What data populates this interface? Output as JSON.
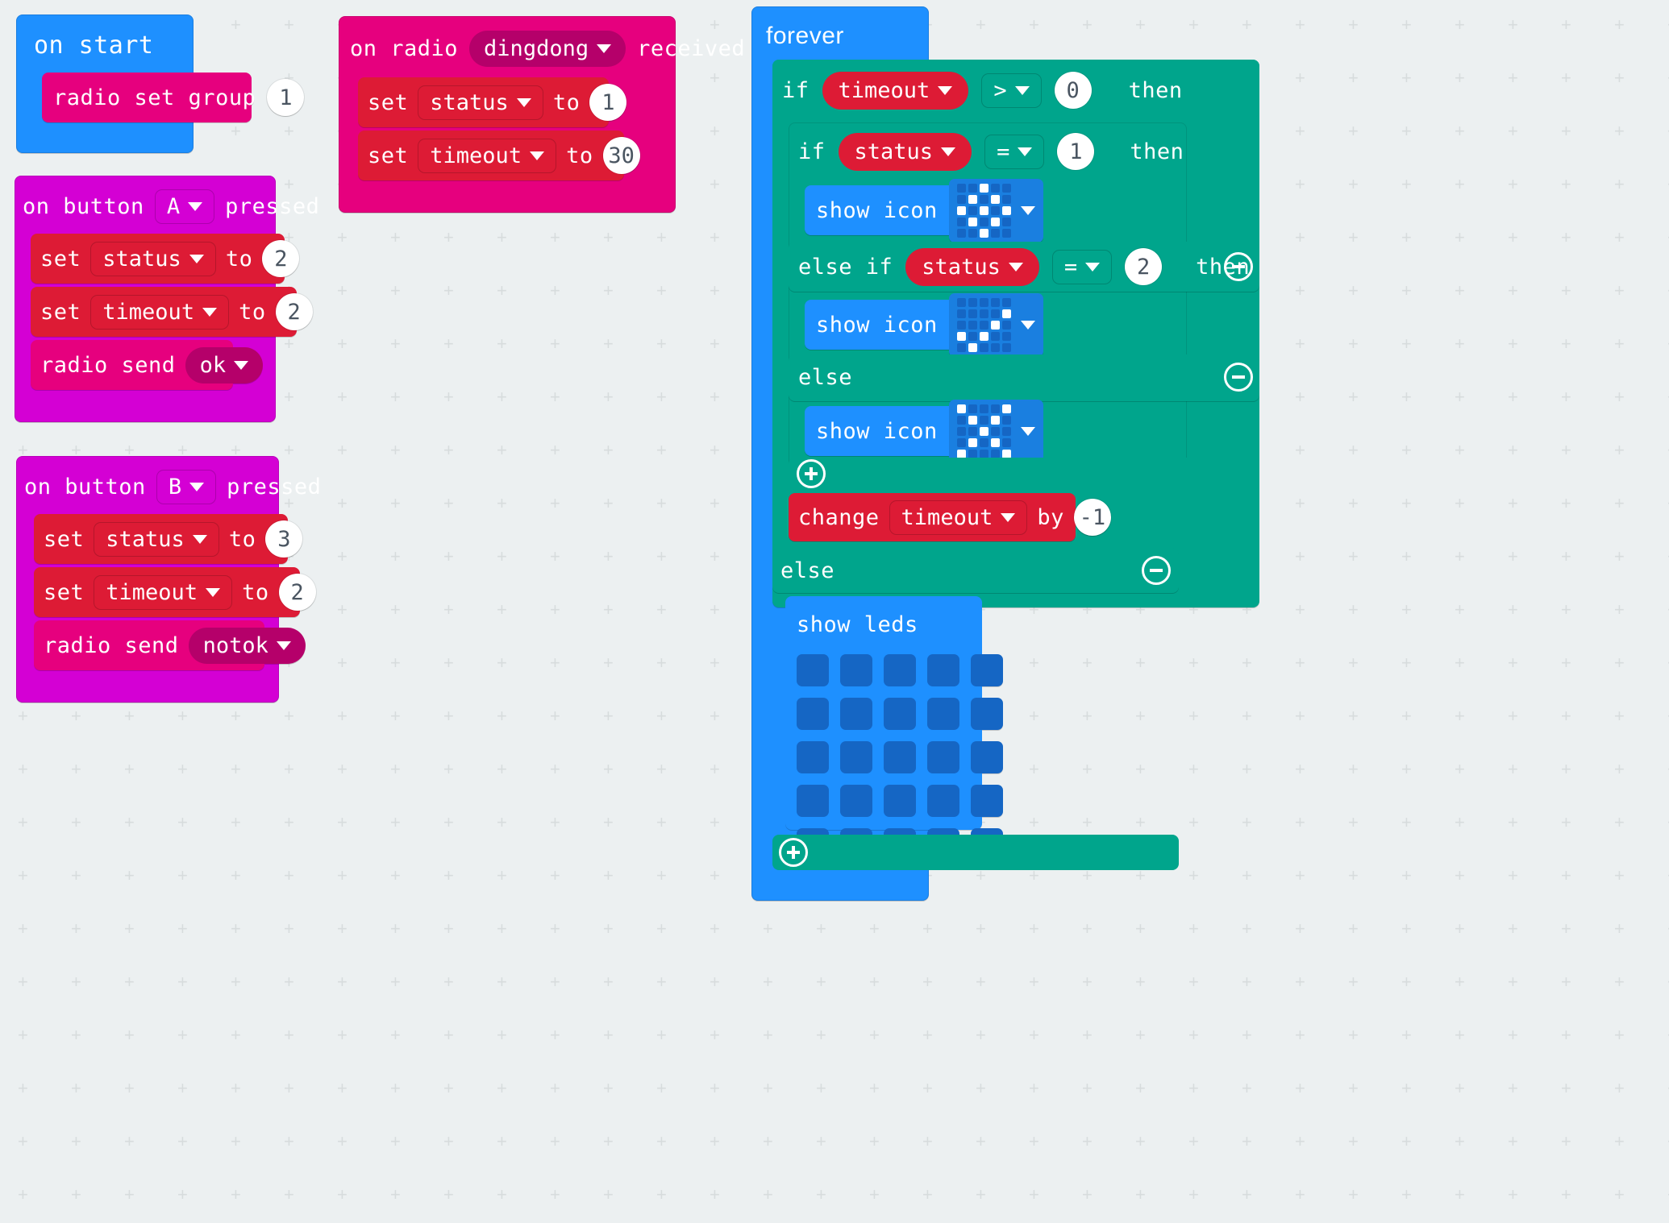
{
  "workspace": {
    "background": "#ecf0f1",
    "grid_marker": "+"
  },
  "palette": {
    "event": "#1e90ff",
    "input": "#d400d4",
    "radio": "#e6007e",
    "variable": "#dd1b35",
    "logic": "#00a58c",
    "led": "#1e90ff",
    "number_bubble_bg": "#ffffff",
    "number_bubble_text": "#4a5561"
  },
  "stacks": {
    "on_start": {
      "hat_label": "on start",
      "children": [
        {
          "kind": "radio-set-group",
          "label": "radio set group",
          "value": "1"
        }
      ]
    },
    "on_button_a": {
      "hat_prefix": "on button",
      "hat_dropdown": "A",
      "hat_suffix": "pressed",
      "children": [
        {
          "kind": "set-variable",
          "label": "set",
          "variable": "status",
          "to_label": "to",
          "value": "2"
        },
        {
          "kind": "set-variable",
          "label": "set",
          "variable": "timeout",
          "to_label": "to",
          "value": "2"
        },
        {
          "kind": "radio-send-string",
          "label": "radio send",
          "value": "ok"
        }
      ]
    },
    "on_button_b": {
      "hat_prefix": "on button",
      "hat_dropdown": "B",
      "hat_suffix": "pressed",
      "children": [
        {
          "kind": "set-variable",
          "label": "set",
          "variable": "status",
          "to_label": "to",
          "value": "3"
        },
        {
          "kind": "set-variable",
          "label": "set",
          "variable": "timeout",
          "to_label": "to",
          "value": "2"
        },
        {
          "kind": "radio-send-string",
          "label": "radio send",
          "value": "notok"
        }
      ]
    },
    "on_radio_received": {
      "hat_prefix": "on radio",
      "hat_dropdown": "dingdong",
      "hat_suffix": "received",
      "children": [
        {
          "kind": "set-variable",
          "label": "set",
          "variable": "status",
          "to_label": "to",
          "value": "1"
        },
        {
          "kind": "set-variable",
          "label": "set",
          "variable": "timeout",
          "to_label": "to",
          "value": "30"
        }
      ]
    },
    "forever": {
      "hat_label": "forever",
      "if_outer": {
        "if_label": "if",
        "condition": {
          "variable": "timeout",
          "operator": ">",
          "value": "0"
        },
        "then_label": "then",
        "if_inner": {
          "if_label": "if",
          "condition": {
            "variable": "status",
            "operator": "=",
            "value": "1"
          },
          "then_label": "then",
          "body": [
            {
              "kind": "show-icon",
              "label": "show icon",
              "icon_name": "diamond-icon"
            }
          ],
          "else_if": {
            "label": "else if",
            "condition": {
              "variable": "status",
              "operator": "=",
              "value": "2"
            },
            "then_label": "then",
            "body": [
              {
                "kind": "show-icon",
                "label": "show icon",
                "icon_name": "arrow-north-east-icon"
              }
            ]
          },
          "else_branch": {
            "label": "else",
            "body": [
              {
                "kind": "show-icon",
                "label": "show icon",
                "icon_name": "no-entry-icon"
              }
            ]
          }
        },
        "after_inner": [
          {
            "kind": "change-variable",
            "label": "change",
            "variable": "timeout",
            "by_label": "by",
            "value": "-1"
          }
        ]
      },
      "else_outer": {
        "label": "else",
        "body": [
          {
            "kind": "show-leds",
            "label": "show leds"
          }
        ]
      }
    }
  },
  "icons": {
    "diamond-icon": [
      [
        0,
        0,
        1,
        0,
        0
      ],
      [
        0,
        1,
        0,
        1,
        0
      ],
      [
        1,
        0,
        1,
        0,
        1
      ],
      [
        0,
        1,
        0,
        1,
        0
      ],
      [
        0,
        0,
        1,
        0,
        0
      ]
    ],
    "arrow-north-east-icon": [
      [
        0,
        0,
        0,
        0,
        0
      ],
      [
        0,
        0,
        0,
        0,
        1
      ],
      [
        0,
        0,
        0,
        1,
        0
      ],
      [
        1,
        0,
        1,
        0,
        0
      ],
      [
        0,
        1,
        0,
        0,
        0
      ]
    ],
    "no-entry-icon": [
      [
        1,
        0,
        0,
        0,
        1
      ],
      [
        0,
        1,
        0,
        1,
        0
      ],
      [
        0,
        0,
        1,
        0,
        0
      ],
      [
        0,
        1,
        0,
        1,
        0
      ],
      [
        1,
        0,
        0,
        0,
        1
      ]
    ],
    "show-leds-grid": [
      [
        0,
        0,
        0,
        0,
        0
      ],
      [
        0,
        0,
        0,
        0,
        0
      ],
      [
        0,
        0,
        0,
        0,
        0
      ],
      [
        0,
        0,
        0,
        0,
        0
      ],
      [
        0,
        0,
        0,
        0,
        0
      ]
    ]
  },
  "controls": {
    "expand_label": "+",
    "collapse_label": "-"
  }
}
